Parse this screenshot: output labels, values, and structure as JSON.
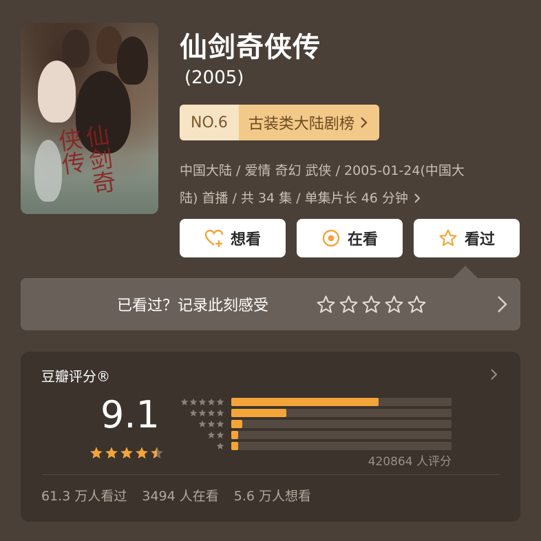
{
  "title": "仙剑奇侠传",
  "year": "(2005)",
  "poster": {
    "brush_text": "仙剑奇侠传"
  },
  "rank": {
    "no": "NO.6",
    "list": "古装类大陆剧榜"
  },
  "meta": {
    "line1": "中国大陆 / 爱情 奇幻 武侠 / 2005-01-24(中国大",
    "line2": "陆) 首播 / 共 34 集 / 单集片长 46 分钟"
  },
  "actions": [
    {
      "label": "想看",
      "icon": "heart-plus-icon"
    },
    {
      "label": "在看",
      "icon": "target-icon"
    },
    {
      "label": "看过",
      "icon": "star-outline-icon"
    }
  ],
  "record": {
    "prompt": "已看过？记录此刻感受",
    "star_count": 5
  },
  "rating": {
    "label": "豆瓣评分®",
    "score": "9.1",
    "stars": 4.5,
    "distribution": [
      {
        "stars": 5,
        "fraction": 0.67
      },
      {
        "stars": 4,
        "fraction": 0.25
      },
      {
        "stars": 3,
        "fraction": 0.05
      },
      {
        "stars": 2,
        "fraction": 0.03
      },
      {
        "stars": 1,
        "fraction": 0.03
      }
    ],
    "count_text": "420864 人评分"
  },
  "stats": {
    "watched": "61.3 万人看过",
    "watching": "3494 人在看",
    "want": "5.6 万人想看"
  },
  "colors": {
    "accent": "#f3a53a",
    "background": "#4a4038",
    "card": "#3b332c",
    "rank_light": "#f6e4c4",
    "rank_dark": "#f3c98a"
  }
}
